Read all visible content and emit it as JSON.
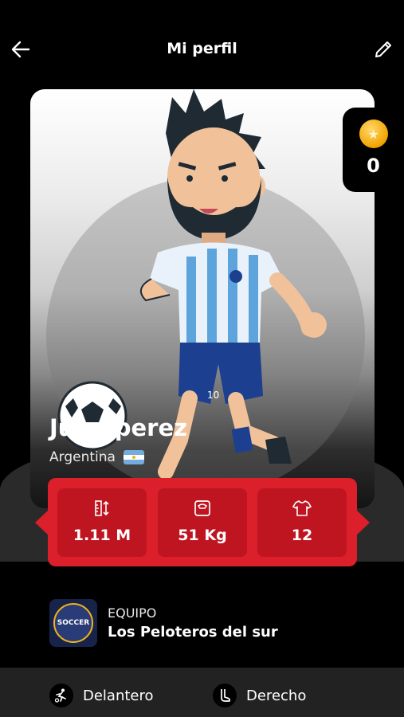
{
  "header": {
    "title": "Mi perfil",
    "back_icon": "arrow-left-icon",
    "edit_icon": "pencil-icon"
  },
  "coins": {
    "icon": "star-coin-icon",
    "count": "0"
  },
  "player": {
    "name": "Juan perez",
    "country": "Argentina",
    "flag": "argentina-flag"
  },
  "stats": [
    {
      "icon": "height-ruler-icon",
      "value": "1.11 M"
    },
    {
      "icon": "weight-scale-icon",
      "value": "51 Kg"
    },
    {
      "icon": "jersey-icon",
      "value": "12"
    }
  ],
  "team": {
    "label": "EQUIPO",
    "name": "Los Peloteros del sur",
    "logo_icon": "soccer-team-logo",
    "logo_text": "SOCCER"
  },
  "attributes": [
    {
      "icon": "running-player-icon",
      "label": "Delantero"
    },
    {
      "icon": "foot-icon",
      "label": "Derecho"
    }
  ],
  "colors": {
    "accent": "#db1f2b",
    "accent_dark": "#bf1521",
    "background": "#000000"
  }
}
